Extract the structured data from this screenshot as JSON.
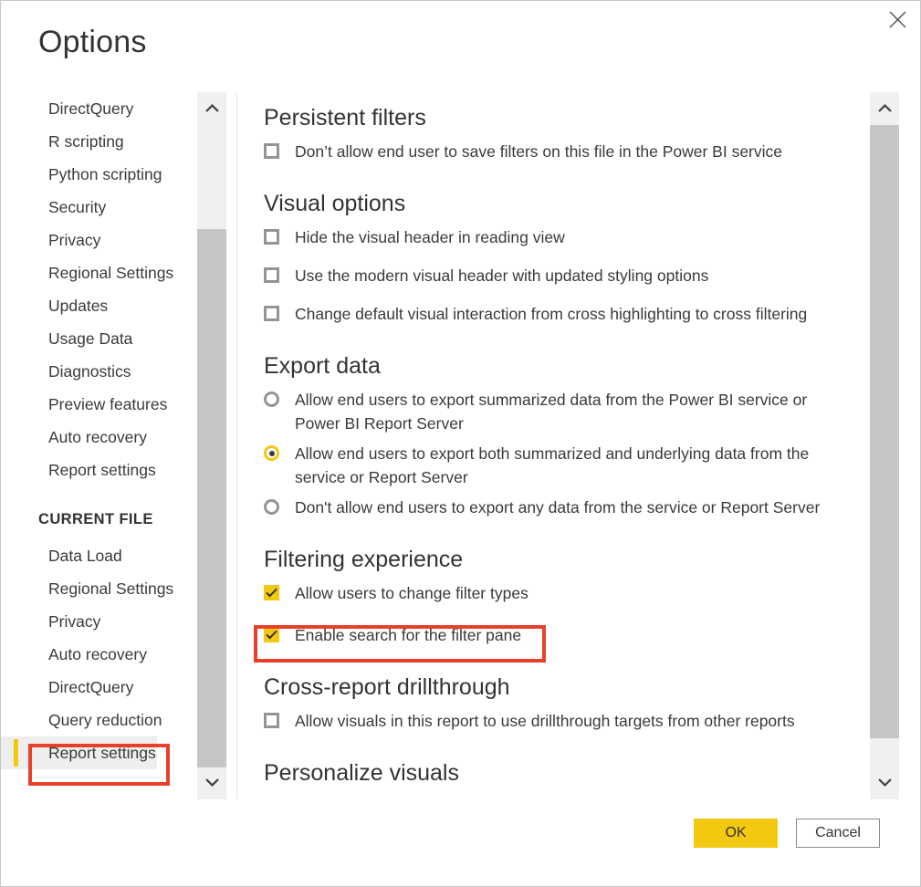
{
  "dialog": {
    "title": "Options",
    "close_icon": "close-icon"
  },
  "sidebar": {
    "global_items": [
      {
        "label": "DirectQuery"
      },
      {
        "label": "R scripting"
      },
      {
        "label": "Python scripting"
      },
      {
        "label": "Security"
      },
      {
        "label": "Privacy"
      },
      {
        "label": "Regional Settings"
      },
      {
        "label": "Updates"
      },
      {
        "label": "Usage Data"
      },
      {
        "label": "Diagnostics"
      },
      {
        "label": "Preview features"
      },
      {
        "label": "Auto recovery"
      },
      {
        "label": "Report settings"
      }
    ],
    "section_label": "CURRENT FILE",
    "current_file_items": [
      {
        "label": "Data Load",
        "selected": false
      },
      {
        "label": "Regional Settings",
        "selected": false
      },
      {
        "label": "Privacy",
        "selected": false
      },
      {
        "label": "Auto recovery",
        "selected": false
      },
      {
        "label": "DirectQuery",
        "selected": false
      },
      {
        "label": "Query reduction",
        "selected": false
      },
      {
        "label": "Report settings",
        "selected": true
      }
    ],
    "scrollbar": {
      "up_icon": "chevron-up-icon",
      "down_icon": "chevron-down-icon"
    }
  },
  "content": {
    "sections": [
      {
        "heading": "Persistent filters",
        "options": [
          {
            "type": "checkbox",
            "checked": false,
            "label": "Don’t allow end user to save filters on this file in the Power BI service"
          }
        ]
      },
      {
        "heading": "Visual options",
        "options": [
          {
            "type": "checkbox",
            "checked": false,
            "label": "Hide the visual header in reading view"
          },
          {
            "type": "checkbox",
            "checked": false,
            "label": "Use the modern visual header with updated styling options"
          },
          {
            "type": "checkbox",
            "checked": false,
            "label": "Change default visual interaction from cross highlighting to cross filtering"
          }
        ]
      },
      {
        "heading": "Export data",
        "options": [
          {
            "type": "radio",
            "checked": false,
            "label": "Allow end users to export summarized data from the Power BI service or Power BI Report Server"
          },
          {
            "type": "radio",
            "checked": true,
            "label": "Allow end users to export both summarized and underlying data from the service or Report Server"
          },
          {
            "type": "radio",
            "checked": false,
            "label": "Don't allow end users to export any data from the service or Report Server"
          }
        ]
      },
      {
        "heading": "Filtering experience",
        "options": [
          {
            "type": "checkbox",
            "checked": true,
            "label": "Allow users to change filter types"
          },
          {
            "type": "checkbox",
            "checked": true,
            "label": "Enable search for the filter pane"
          }
        ]
      },
      {
        "heading": "Cross-report drillthrough",
        "options": [
          {
            "type": "checkbox",
            "checked": false,
            "label": "Allow visuals in this report to use drillthrough targets from other reports"
          }
        ]
      },
      {
        "heading": "Personalize visuals",
        "options": []
      }
    ],
    "scrollbar": {
      "up_icon": "chevron-up-icon",
      "down_icon": "chevron-down-icon"
    }
  },
  "footer": {
    "ok_label": "OK",
    "cancel_label": "Cancel"
  },
  "colors": {
    "accent": "#F2C811",
    "annotation": "#E8402A",
    "text": "#3A3A3A",
    "border": "#C8C8C8"
  }
}
